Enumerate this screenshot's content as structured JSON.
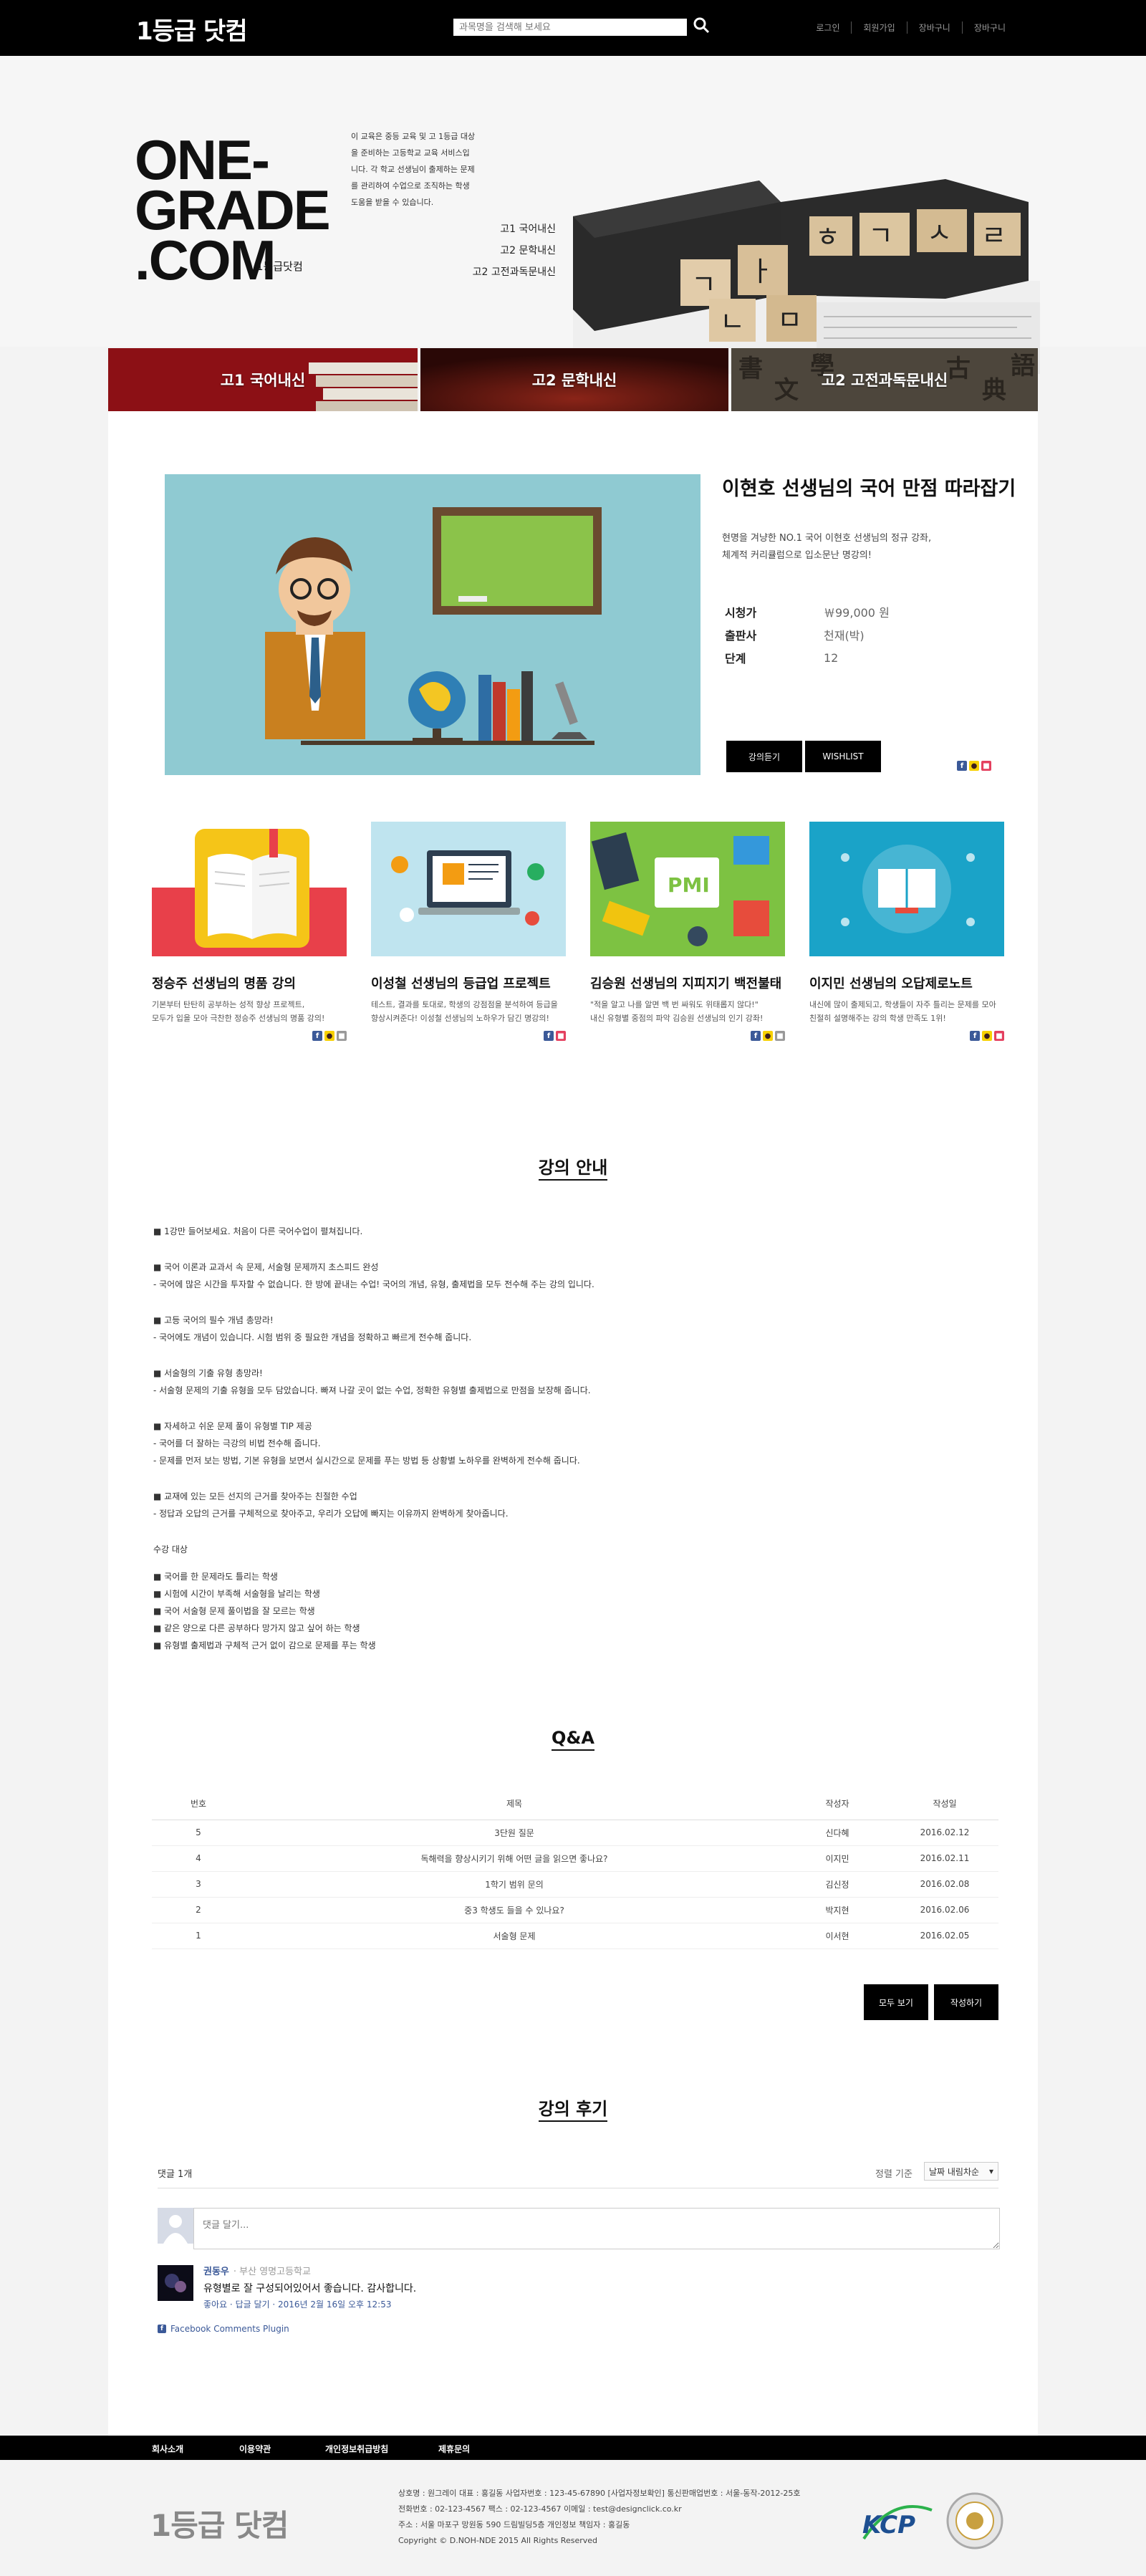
{
  "header": {
    "logo": "1등급 닷컴",
    "search_placeholder": "과목명을 검색해 보세요",
    "links": [
      "로그인",
      "회원가입",
      "장바구니",
      "장바구니"
    ]
  },
  "hero": {
    "title_lines": [
      "ONE-",
      "GRADE",
      ".COM"
    ],
    "sub": "1등급닷컴",
    "desc": "이 교육은 중등 교육 및 고 1등급 대상을 준비하는 고등학교 교육 서비스입니다. 각 학교 선생님이 출제하는 문제를 관리하여 수업으로 조직하는 학생 도움을 받을 수 있습니다.",
    "list": [
      "고1 국어내신",
      "고2 문학내신",
      "고2 고전과독문내신"
    ],
    "dots": 2
  },
  "categories": [
    "고1 국어내신",
    "고2 문학내신",
    "고2 고전과독문내신"
  ],
  "featured": {
    "title": "이현호 선생님의 국어 만점 따라잡기",
    "desc1": "현명을 겨냥한 NO.1 국어 이현호 선생님의 정규 강좌,",
    "desc2": "체계적 커리큘럼으로 입소문난 명강의!",
    "rows": [
      {
        "k": "시청가",
        "v": "￦99,000 원"
      },
      {
        "k": "출판사",
        "v": "천재(박)"
      },
      {
        "k": "단계",
        "v": "12"
      }
    ],
    "btn_enroll": "강의듣기",
    "btn_wish": "WISHLIST"
  },
  "cards": [
    {
      "title": "정승주 선생님의 명품 강의",
      "desc1": "기본부터 탄탄히 공부하는 성적 향상 프로젝트,",
      "desc2": "모두가 입을 모아 극찬한 정승주 선생님의 명품 강의!"
    },
    {
      "title": "이성철 선생님의 등급업 프로젝트",
      "desc1": "테스트, 결과를 토대로, 학생의 강점점을 분석하여 등급을",
      "desc2": "향상시켜준다! 이성철 선생님의 노하우가 담긴 명강의!"
    },
    {
      "title": "김승원 선생님의 지피지기 백전불태",
      "desc1": "\"적을 알고 나를 알면 백 번 싸워도 위태롭지 않다!\"",
      "desc2": "내신 유형별 중점의 파악 김승원 선생님의 인기 강좌!"
    },
    {
      "title": "이지민 선생님의 오답제로노트",
      "desc1": "내신에 많이 출제되고, 학생들이 자주 틀리는 문제를 모아",
      "desc2": "친절히 설명해주는 강의 학생 만족도 1위!"
    }
  ],
  "info": {
    "title": "강의 안내",
    "blocks": [
      [
        "■ 1강만 들어보세요. 처음이 다른 국어수업이 펼쳐집니다."
      ],
      [
        "■ 국어 이론과 교과서 속 문제, 서술형 문제까지 초스피드 완성",
        "- 국어에 많은 시간을 투자할 수 없습니다. 한 방에 끝내는 수업! 국어의 개념, 유형, 출제법을 모두 전수해 주는 강의 입니다."
      ],
      [
        "■ 고등 국어의 필수 개념 총망라!",
        "- 국어에도 개념이 있습니다. 시험 범위 중 필요한 개념을 정확하고 빠르게 전수해 줍니다."
      ],
      [
        "■ 서술형의 기출 유형 총망라!",
        "- 서술형 문제의 기출 유형을 모두 담았습니다. 빠져 나갈 곳이 없는 수업, 정확한 유형별 출제법으로 만점을 보장해 줍니다."
      ],
      [
        "■ 자세하고 쉬운 문제 풀이 유형별 TIP 제공",
        "- 국어를 더 잘하는 극강의 비법 전수해 줍니다.",
        "- 문제를 먼저 보는 방법, 기본 유형을 보면서 실시간으로 문제를 푸는 방법 등 상황별 노하우를 완벽하게 전수해 줍니다."
      ],
      [
        "■ 교재에 있는 모든 선지의 근거를 찾아주는 친절한 수업",
        "- 정답과 오답의 근거를 구체적으로 찾아주고, 우리가 오답에 빠지는 이유까지 완벽하게 찾아줍니다."
      ],
      [
        "수강 대상"
      ],
      [
        "■ 국어를 한 문제라도 틀리는 학생",
        "■ 시험에 시간이 부족해 서술형을 날리는 학생",
        "■ 국어 서술형 문제 풀이법을 잘 모르는 학생",
        "■ 같은 양으로 다른 공부하다 망가지 않고 싶어 하는 학생",
        "■ 유형별 출제법과 구체적 근거 없이 감으로 문제를 푸는 학생"
      ]
    ]
  },
  "qna": {
    "title": "Q&A",
    "headers": [
      "번호",
      "제목",
      "작성자",
      "작성일"
    ],
    "rows": [
      [
        "5",
        "3단원 질문",
        "신다혜",
        "2016.02.12"
      ],
      [
        "4",
        "독해력을 향상시키기 위해 어떤 글을 읽으면 좋나요?",
        "이지민",
        "2016.02.11"
      ],
      [
        "3",
        "1학기 범위 문의",
        "김신정",
        "2016.02.08"
      ],
      [
        "2",
        "중3 학생도 들을 수 있나요?",
        "박지현",
        "2016.02.06"
      ],
      [
        "1",
        "서술형 문제",
        "이서현",
        "2016.02.05"
      ]
    ],
    "btn_all": "모두 보기",
    "btn_write": "작성하기"
  },
  "review": {
    "title": "강의 후기",
    "count": "댓글 1개",
    "sort_label": "정렬 기준",
    "sort_value": "날짜 내림차순",
    "input_placeholder": "댓글 달기...",
    "comment": {
      "name": "권동우",
      "school": "· 부산 영명고등학교",
      "text": "유형별로 잘 구성되어있어서 좋습니다. 감사합니다.",
      "meta": "좋아요 · 답글 달기 · 2016년 2월 16일 오후 12:53"
    },
    "plugin": "Facebook Comments Plugin"
  },
  "footer": {
    "links": [
      "회사소개",
      "이용약관",
      "개인정보취급방침",
      "제휴문의"
    ],
    "logo": "1등급 닷컴",
    "lines": [
      "상호명 : 원그레이 대표 : 홍길동 사업자번호 : 123-45-67890 [사업자정보확인] 통신판매업번호 : 서울-동작-2012-25호",
      "전화번호 : 02-123-4567 팩스 : 02-123-4567 이메일 : test@designclick.co.kr",
      "주소 : 서울 마포구 망원동 590 드림빌딩5층 개인정보 책임자 : 홍길동",
      "Copyright © D.NOH-NDE 2015 All Rights Reserved"
    ],
    "kcp": "KCP"
  }
}
